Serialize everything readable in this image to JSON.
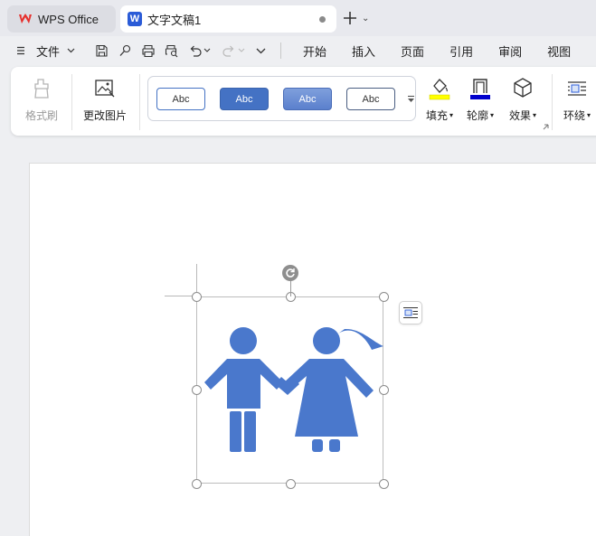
{
  "tabs": {
    "app_label": "WPS Office",
    "doc_label": "文字文稿1"
  },
  "menubar": {
    "file_label": "文件",
    "tabs": [
      "开始",
      "插入",
      "页面",
      "引用",
      "审阅",
      "视图"
    ]
  },
  "ribbon": {
    "format_painter": "格式刷",
    "change_picture": "更改图片",
    "style_presets": [
      "Abc",
      "Abc",
      "Abc",
      "Abc"
    ],
    "fill": "填充",
    "outline": "轮廓",
    "effects": "效果",
    "wrap": "环绕"
  },
  "colors": {
    "accent": "#4472c4",
    "fill_swatch": "#ffff00",
    "outline_swatch": "#0000cc",
    "icon_blue": "#4a78cc"
  },
  "icons": {
    "app": "wps-logo-icon",
    "doc": "writer-doc-icon",
    "rotate": "rotate-icon",
    "wrap": "text-wrap-icon"
  }
}
